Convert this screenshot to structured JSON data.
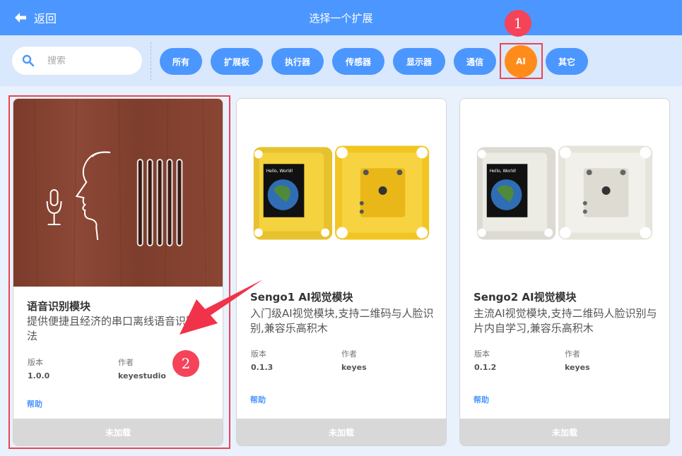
{
  "header": {
    "back_label": "返回",
    "title": "选择一个扩展"
  },
  "search": {
    "placeholder": "搜索"
  },
  "categories": [
    "所有",
    "扩展板",
    "执行器",
    "传感器",
    "显示器",
    "通信",
    "AI",
    "其它"
  ],
  "active_category": "AI",
  "annotations": {
    "one": "1",
    "two": "2"
  },
  "cards": [
    {
      "title": "语音识别模块",
      "desc": "提供便捷且经济的串口离线语音识别方法",
      "version_label": "版本",
      "version": "1.0.0",
      "author_label": "作者",
      "author": "keyestudio",
      "help": "帮助",
      "status": "未加载"
    },
    {
      "title": "Sengo1 AI视觉模块",
      "desc": "入门级AI视觉模块,支持二维码与人脸识别,兼容乐高积木",
      "version_label": "版本",
      "version": "0.1.3",
      "author_label": "作者",
      "author": "keyes",
      "help": "帮助",
      "status": "未加载",
      "screen_text": "Hello, World!"
    },
    {
      "title": "Sengo2 AI视觉模块",
      "desc": "主流AI视觉模块,支持二维码人脸识别与片内自学习,兼容乐高积木",
      "version_label": "版本",
      "version": "0.1.2",
      "author_label": "作者",
      "author": "keyes",
      "help": "帮助",
      "status": "未加载",
      "screen_text": "Hello, World!"
    }
  ],
  "colors": {
    "primary": "#4c97ff",
    "active": "#ff8c1a",
    "highlight": "#e94555"
  }
}
